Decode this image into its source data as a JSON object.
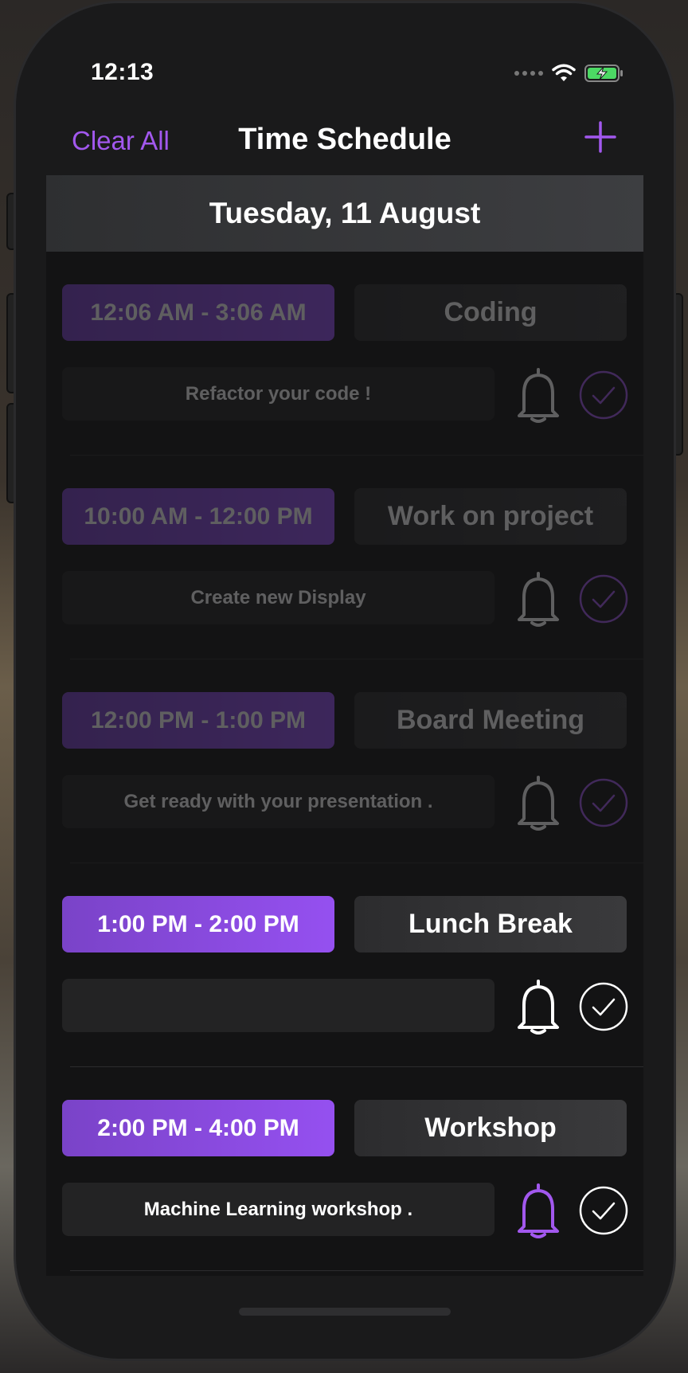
{
  "status_bar": {
    "time": "12:13"
  },
  "nav": {
    "left_action": "Clear All",
    "title": "Time Schedule",
    "add_icon": "plus-icon"
  },
  "day": {
    "date": "Tuesday, 11 August"
  },
  "colors": {
    "accent": "#9550f0",
    "background": "#131314",
    "pill": "#2c2c2e"
  },
  "events": [
    {
      "time": "12:06 AM - 3:06 AM",
      "title": "Coding",
      "note": "Refactor your code !",
      "state": "past",
      "reminder_on": false
    },
    {
      "time": "10:00 AM - 12:00 PM",
      "title": "Work on project",
      "note": "Create new Display",
      "state": "past",
      "reminder_on": false
    },
    {
      "time": "12:00 PM - 1:00 PM",
      "title": "Board Meeting",
      "note": "Get ready with your presentation .",
      "state": "past",
      "reminder_on": false
    },
    {
      "time": "1:00 PM - 2:00 PM",
      "title": "Lunch Break",
      "note": "",
      "state": "upcoming",
      "reminder_on": false
    },
    {
      "time": "2:00 PM - 4:00 PM",
      "title": "Workshop",
      "note": "Machine Learning workshop .",
      "state": "upcoming",
      "reminder_on": true
    }
  ]
}
